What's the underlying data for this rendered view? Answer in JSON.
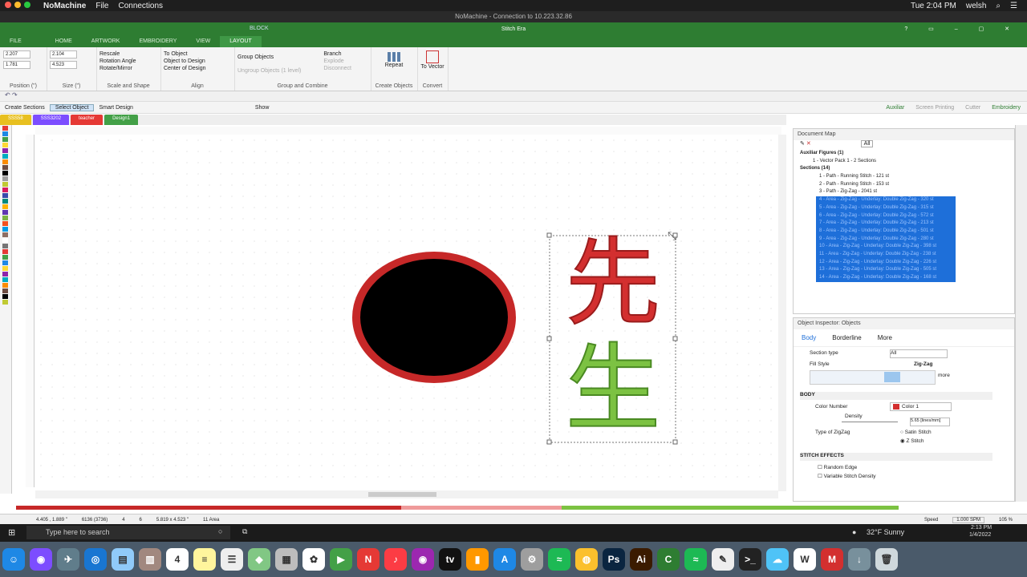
{
  "mac_menu": {
    "app": "NoMachine",
    "file": "File",
    "connections": "Connections",
    "time": "Tue 2:04 PM",
    "user": "welsh"
  },
  "remote_title": "NoMachine - Connection to 10.223.32.86",
  "app_title": "Stitch Era",
  "ribbon_tabs": [
    "FILE",
    "HOME",
    "ARTWORK",
    "EMBROIDERY",
    "VIEW",
    "LAYOUT"
  ],
  "block_label": "BLOCK",
  "ribbon": {
    "position": {
      "x": "2.207",
      "y": "1.781",
      "label": "Position (\")"
    },
    "size": {
      "w": "2.104",
      "h": "4.523",
      "label": "Size (\")"
    },
    "scale_shape": {
      "items": [
        "Rescale",
        "Rotation Angle",
        "Rotate/Mirror"
      ],
      "label": "Scale and Shape"
    },
    "align": {
      "items": [
        "To Object",
        "Object to Design",
        "Center of Design"
      ],
      "label": "Align"
    },
    "group_combine": {
      "items": [
        "Group Objects",
        "Ungroup Objects (1 level)",
        "Branch",
        "Explode",
        "Disconnect"
      ],
      "label": "Group and Combine"
    },
    "create_objects": {
      "item": "Repeat",
      "label": "Create Objects"
    },
    "convert": {
      "item": "To Vector",
      "label": "Convert"
    }
  },
  "toolbar": {
    "create_sections": "Create Sections",
    "select_object": "Select Object",
    "smart_design": "Smart Design",
    "show": "Show",
    "right_items": [
      "Auxiliar",
      "Screen Printing",
      "Cutter",
      "Embroidery"
    ]
  },
  "doc_tabs": [
    {
      "label": "SSS58",
      "color": "#e8c020"
    },
    {
      "label": "SSS3202",
      "color": "#7c4dff"
    },
    {
      "label": "teacher",
      "color": "#e53935"
    },
    {
      "label": "Design1",
      "color": "#43a047"
    }
  ],
  "palette_colors": [
    "#e53935",
    "#1e88e5",
    "#43a047",
    "#fdd835",
    "#8e24aa",
    "#00acc1",
    "#fb8c00",
    "#6d4c41",
    "#000000",
    "#9e9e9e",
    "#c0ca33",
    "#d81b60",
    "#3949ab",
    "#00897b",
    "#ffb300",
    "#5e35b1",
    "#7cb342",
    "#f4511e",
    "#039be5",
    "#8d6e63",
    "#ffffff",
    "#757575",
    "#e53935",
    "#43a047",
    "#1e88e5",
    "#fdd835",
    "#8e24aa",
    "#00acc1",
    "#fb8c00",
    "#6d4c41",
    "#000000",
    "#c0ca33"
  ],
  "canvas": {
    "char1": "先",
    "char2": "生",
    "red": "#d32f2f",
    "green": "#7cc242"
  },
  "doc_map": {
    "title": "Document Map",
    "all_label": "All",
    "tree": [
      {
        "text": "Auxiliar Figures (1)",
        "indent": 0,
        "bold": true
      },
      {
        "text": "1 - Vector Pack 1 - 2 Sections",
        "indent": 2
      },
      {
        "text": "Sections (14)",
        "indent": 0,
        "bold": true
      },
      {
        "text": "1 - Path - Running Stitch - 121 st",
        "indent": 3
      },
      {
        "text": "2 - Path - Running Stitch - 153 st",
        "indent": 3
      },
      {
        "text": "3 - Path - Zig-Zag - 2041 st",
        "indent": 3
      },
      {
        "text": "4 - Area - Zig-Zag - Underlay: Double Zig-Zag - 320 st",
        "indent": 3,
        "sel": true
      },
      {
        "text": "5 - Area - Zig-Zag - Underlay: Double Zig-Zag - 315 st",
        "indent": 3,
        "sel": true
      },
      {
        "text": "6 - Area - Zig-Zag - Underlay: Double Zig-Zag - 572 st",
        "indent": 3,
        "sel": true
      },
      {
        "text": "7 - Area - Zig-Zag - Underlay: Double Zig-Zag - 213 st",
        "indent": 3,
        "sel": true
      },
      {
        "text": "8 - Area - Zig-Zag - Underlay: Double Zig-Zag - 501 st",
        "indent": 3,
        "sel": true
      },
      {
        "text": "9 - Area - Zig-Zag - Underlay: Double Zig-Zag - 280 st",
        "indent": 3,
        "sel": true
      },
      {
        "text": "10 - Area - Zig-Zag - Underlay: Double Zig-Zag - 398 st",
        "indent": 3,
        "sel": true
      },
      {
        "text": "11 - Area - Zig-Zag - Underlay: Double Zig-Zag - 238 st",
        "indent": 3,
        "sel": true
      },
      {
        "text": "12 - Area - Zig-Zag - Underlay: Double Zig-Zag - 226 st",
        "indent": 3,
        "sel": true
      },
      {
        "text": "13 - Area - Zig-Zag - Underlay: Double Zig-Zag - 505 st",
        "indent": 3,
        "sel": true
      },
      {
        "text": "14 - Area - Zig-Zag - Underlay: Double Zig-Zag - 168 st",
        "indent": 3,
        "sel": true
      }
    ]
  },
  "inspector": {
    "title": "Object Inspector: Objects",
    "tabs": [
      "Body",
      "Borderline",
      "More"
    ],
    "section_type_label": "Section type",
    "section_type_value": "All",
    "fill_style_label": "Fill Style",
    "fill_style_value": "Zig-Zag",
    "more": "more",
    "body_header": "BODY",
    "color_number_label": "Color Number",
    "color_value": "Color 1",
    "density_label": "Density",
    "density_value": "5.65 [lines/mm]",
    "type_zigzag_label": "Type of ZigZag",
    "satin": "Satin Stitch",
    "zstitch": "Z Stitch",
    "effects_header": "STITCH EFFECTS",
    "random_edge": "Random Edge",
    "variable_density": "Variable Stitch Density"
  },
  "status": {
    "coords": "4.405 , 1.889 \"",
    "stitches": "6136 (3736)",
    "c1": "4",
    "c2": "6",
    "size": "5.819 x 4.523 \"",
    "selection": "11 Area",
    "speed_label": "Speed",
    "speed_value": "1.000 SPM",
    "zoom": "105 %"
  },
  "windows": {
    "search_placeholder": "Type here to search",
    "weather": "32°F Sunny",
    "time": "2:13 PM",
    "date": "1/4/2022"
  },
  "dock_icons": [
    {
      "name": "finder",
      "color": "#1e88e5",
      "g": "☺"
    },
    {
      "name": "siri",
      "color": "#7c4dff",
      "g": "◉"
    },
    {
      "name": "launchpad",
      "color": "#607d8b",
      "g": "✈"
    },
    {
      "name": "safari",
      "color": "#1976d2",
      "g": "◎"
    },
    {
      "name": "preview",
      "color": "#90caf9",
      "g": "▤"
    },
    {
      "name": "books-brown",
      "color": "#a1887f",
      "g": "▥"
    },
    {
      "name": "calendar",
      "color": "#ffffff",
      "g": "4"
    },
    {
      "name": "notes",
      "color": "#fff59d",
      "g": "≡"
    },
    {
      "name": "reminders",
      "color": "#eeeeee",
      "g": "☰"
    },
    {
      "name": "maps",
      "color": "#81c784",
      "g": "◆"
    },
    {
      "name": "files",
      "color": "#bdbdbd",
      "g": "▦"
    },
    {
      "name": "photos",
      "color": "#ffffff",
      "g": "✿"
    },
    {
      "name": "facetime",
      "color": "#43a047",
      "g": "▶"
    },
    {
      "name": "news",
      "color": "#e53935",
      "g": "N"
    },
    {
      "name": "music",
      "color": "#fc3c44",
      "g": "♪"
    },
    {
      "name": "podcasts",
      "color": "#9c27b0",
      "g": "◉"
    },
    {
      "name": "tv",
      "color": "#111111",
      "g": "tv"
    },
    {
      "name": "books",
      "color": "#ff9800",
      "g": "▮"
    },
    {
      "name": "appstore",
      "color": "#1e88e5",
      "g": "A"
    },
    {
      "name": "settings",
      "color": "#9e9e9e",
      "g": "⚙"
    },
    {
      "name": "spotify-green",
      "color": "#1db954",
      "g": "≈"
    },
    {
      "name": "chrome",
      "color": "#fbc02d",
      "g": "◍"
    },
    {
      "name": "photoshop",
      "color": "#0a2540",
      "g": "Ps"
    },
    {
      "name": "illustrator",
      "color": "#3b1b00",
      "g": "Ai"
    },
    {
      "name": "cricut",
      "color": "#2e7d32",
      "g": "C"
    },
    {
      "name": "spotify",
      "color": "#1db954",
      "g": "≈"
    },
    {
      "name": "textedit",
      "color": "#eeeeee",
      "g": "✎"
    },
    {
      "name": "terminal",
      "color": "#222222",
      "g": ">_"
    },
    {
      "name": "cloud",
      "color": "#4fc3f7",
      "g": "☁"
    },
    {
      "name": "word",
      "color": "#ffffff",
      "g": "W"
    },
    {
      "name": "studio",
      "color": "#d32f2f",
      "g": "M"
    },
    {
      "name": "downloads",
      "color": "#78909c",
      "g": "↓"
    },
    {
      "name": "trash",
      "color": "#cfd8dc",
      "g": "🗑"
    }
  ]
}
